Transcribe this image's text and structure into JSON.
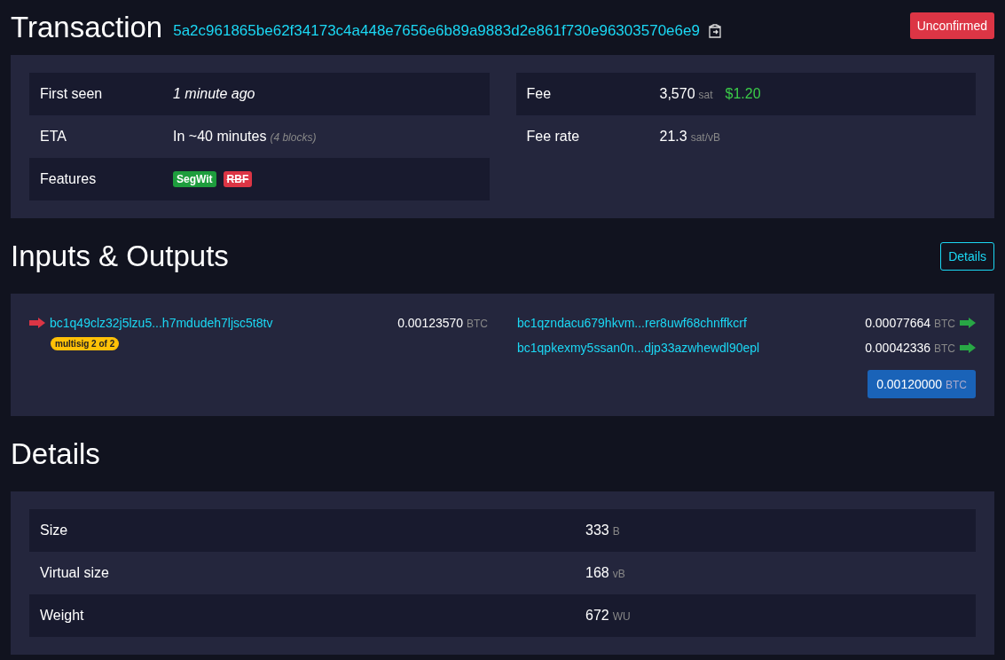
{
  "header": {
    "title": "Transaction",
    "txid": "5a2c961865be62f34173c4a448e7656e6b89a9883d2e861f730e96303570e6e9",
    "status": "Unconfirmed"
  },
  "summary": {
    "left": [
      {
        "label": "First seen",
        "kind": "time",
        "value": "1 minute ago"
      },
      {
        "label": "ETA",
        "kind": "eta",
        "value": "In ~40 minutes",
        "note": "(4 blocks)"
      },
      {
        "label": "Features",
        "kind": "features",
        "features": [
          {
            "label": "SegWit",
            "color": "#1e9d3d",
            "enabled": true
          },
          {
            "label": "RBF",
            "color": "#dc3545",
            "enabled": false
          }
        ]
      }
    ],
    "right": [
      {
        "label": "Fee",
        "kind": "fee",
        "value": "3,570",
        "unit": "sat",
        "fiat": "$1.20"
      },
      {
        "label": "Fee rate",
        "kind": "rate",
        "value": "21.3",
        "unit": "sat/vB"
      }
    ]
  },
  "io": {
    "title": "Inputs & Outputs",
    "details_button": "Details",
    "inputs": [
      {
        "address": "bc1q49clz32j5lzu5...h7mdudeh7ljsc5t8tv",
        "amount": "0.00123570",
        "unit": "BTC",
        "tag": "multisig 2 of 2"
      }
    ],
    "outputs": [
      {
        "address": "bc1qzndacu679hkvm...rer8uwf68chnffkcrf",
        "amount": "0.00077664",
        "unit": "BTC"
      },
      {
        "address": "bc1qpkexmy5ssan0n...djp33azwhewdl90epl",
        "amount": "0.00042336",
        "unit": "BTC"
      }
    ],
    "total": {
      "amount": "0.00120000",
      "unit": "BTC"
    }
  },
  "details": {
    "title": "Details",
    "rows": [
      {
        "label": "Size",
        "value": "333",
        "unit": "B"
      },
      {
        "label": "Virtual size",
        "value": "168",
        "unit": "vB"
      },
      {
        "label": "Weight",
        "value": "672",
        "unit": "WU"
      }
    ]
  }
}
